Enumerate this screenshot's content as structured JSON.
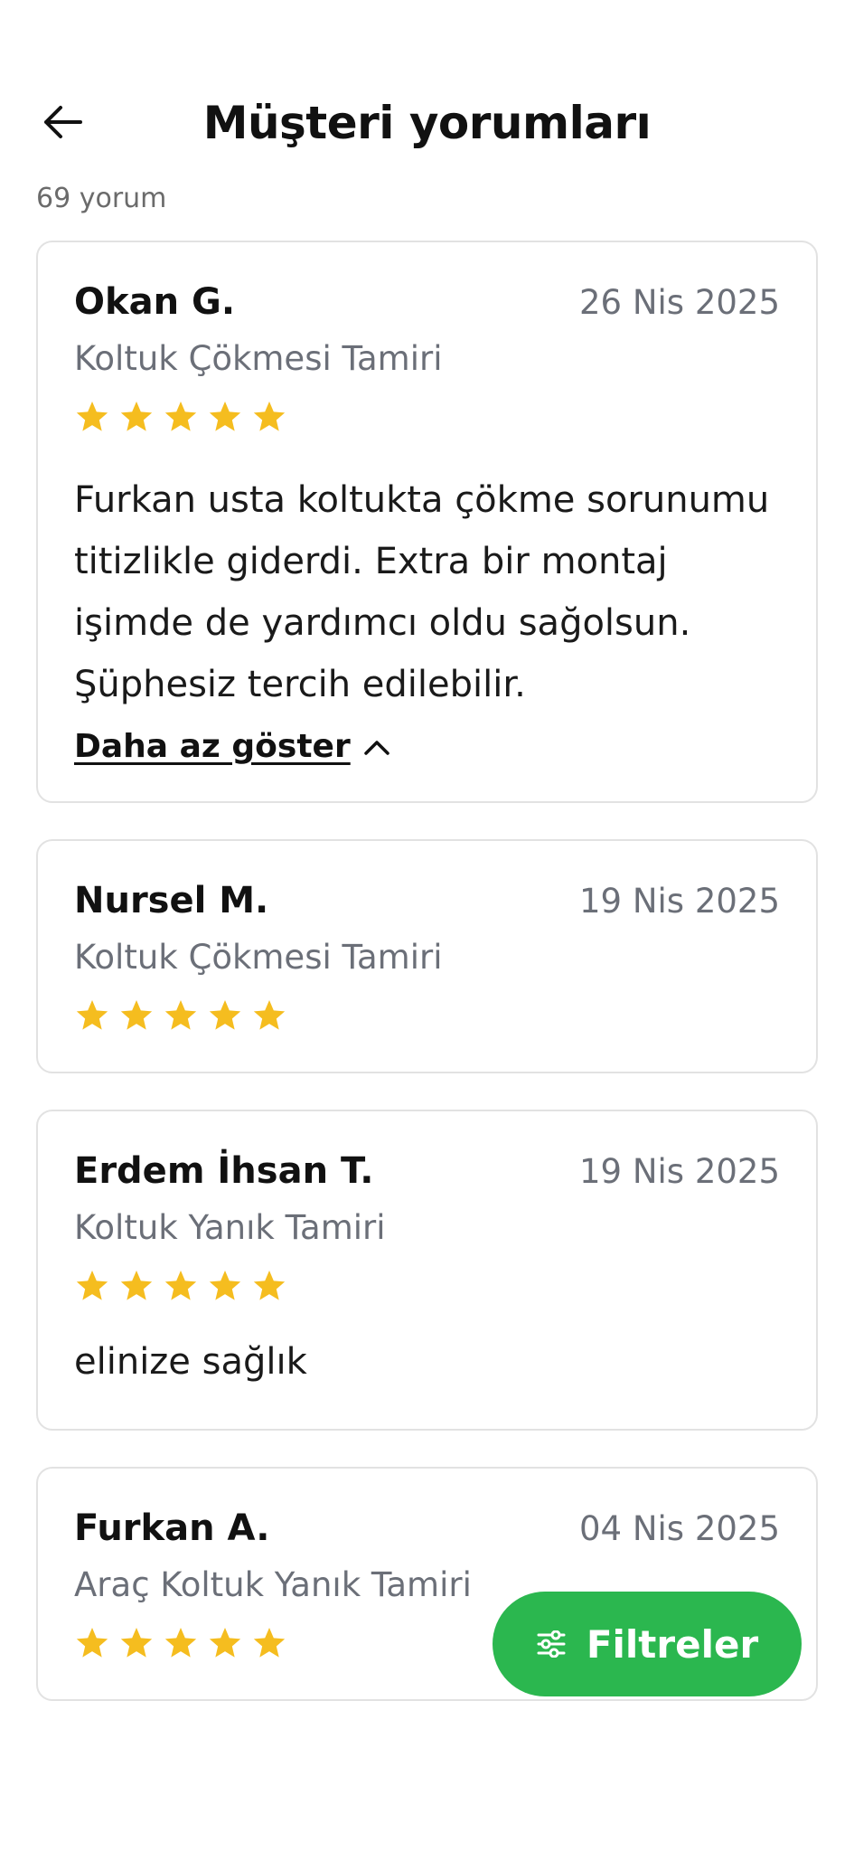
{
  "header": {
    "title": "Müşteri yorumları",
    "back_icon": "arrow-left-icon"
  },
  "summary": {
    "count_label": "69 yorum"
  },
  "reviews": [
    {
      "name": "Okan G.",
      "date": "26 Nis 2025",
      "service": "Koltuk Çökmesi Tamiri",
      "rating": 5,
      "comment": "Furkan usta koltukta çökme sorunumu titizlikle giderdi. Extra bir montaj işimde de yardımcı oldu sağolsun. Şüphesiz tercih edilebilir.",
      "toggle_label": "Daha az göster"
    },
    {
      "name": "Nursel M.",
      "date": "19 Nis 2025",
      "service": "Koltuk Çökmesi Tamiri",
      "rating": 5
    },
    {
      "name": "Erdem İhsan T.",
      "date": "19 Nis 2025",
      "service": "Koltuk Yanık Tamiri",
      "rating": 5,
      "comment": "elinize sağlık"
    },
    {
      "name": "Furkan A.",
      "date": "04 Nis 2025",
      "service": "Araç Koltuk Yanık Tamiri",
      "rating": 5
    }
  ],
  "filter_button": {
    "label": "Filtreler",
    "icon": "sliders-icon"
  },
  "colors": {
    "star": "#F5BD1F",
    "accent_green": "#2BB74F",
    "muted_text": "#6B6F78",
    "card_border": "#E2E2E2"
  }
}
